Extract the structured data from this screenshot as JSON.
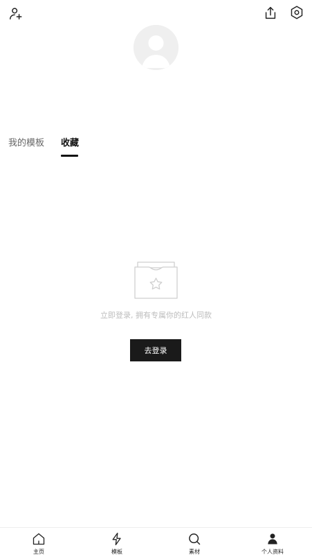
{
  "tabs": {
    "templates": "我的模板",
    "favorites": "收藏"
  },
  "empty_state": {
    "message": "立即登录, 拥有专属你的红人同款",
    "login_button": "去登录"
  },
  "bottom_nav": [
    {
      "label": "主页",
      "icon": "home-icon"
    },
    {
      "label": "模板",
      "icon": "lightning-icon"
    },
    {
      "label": "素材",
      "icon": "search-icon"
    },
    {
      "label": "个人资料",
      "icon": "person-icon",
      "active": true
    }
  ],
  "colors": {
    "primary": "#1a1a1a",
    "muted_text": "#bdbdbd",
    "tab_inactive": "#666666",
    "avatar_bg": "#efefef"
  }
}
